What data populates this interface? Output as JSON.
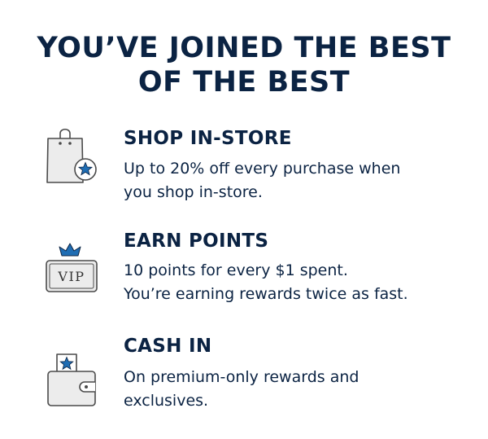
{
  "headline": {
    "line1": "YOU’VE JOINED THE BEST",
    "line2": "OF THE BEST"
  },
  "colors": {
    "navy": "#0b2343",
    "accent_blue": "#1f6db3",
    "icon_gray": "#ececec",
    "icon_stroke": "#4a4a4a"
  },
  "benefits": [
    {
      "icon": "shopping-bag-star-icon",
      "title": "SHOP IN-STORE",
      "lines": [
        "Up to 20% off every purchase when",
        "you shop in-store."
      ]
    },
    {
      "icon": "vip-crown-card-icon",
      "badge_text": "VIP",
      "title": "EARN POINTS",
      "lines": [
        "10 points for every $1 spent.",
        "You’re earning rewards twice as fast."
      ]
    },
    {
      "icon": "wallet-star-icon",
      "title": "CASH IN",
      "lines": [
        "On premium-only rewards and",
        "exclusives."
      ]
    }
  ]
}
